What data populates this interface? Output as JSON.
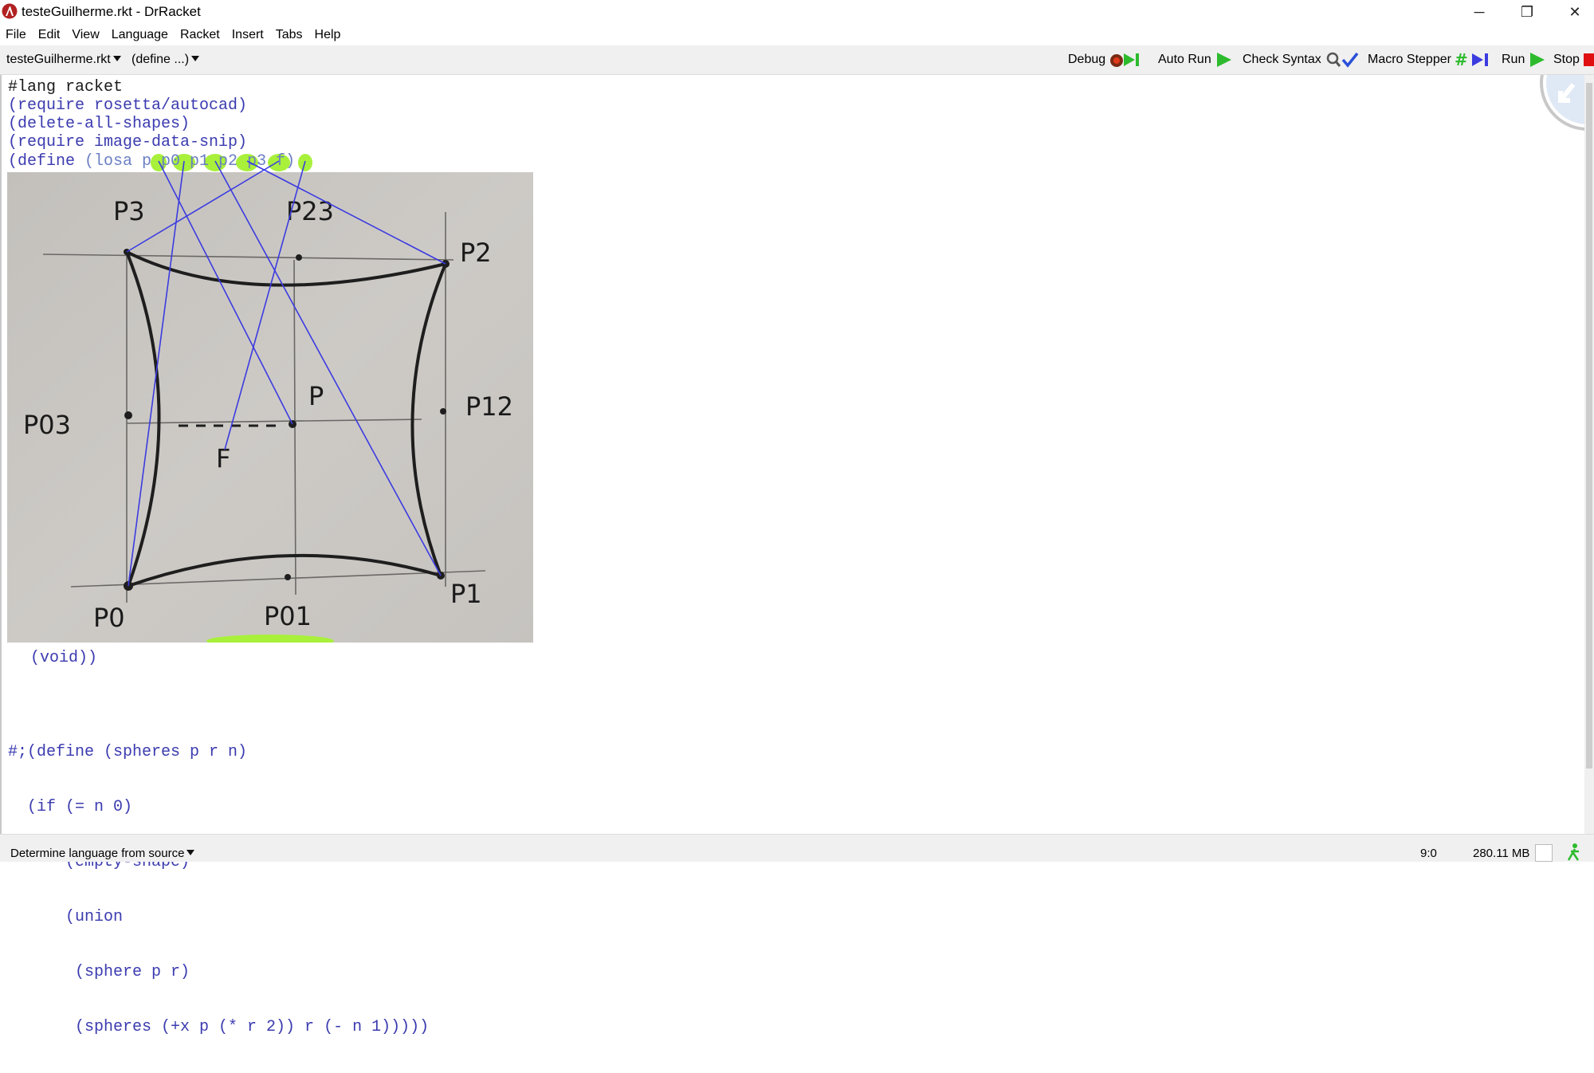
{
  "window": {
    "title": "testeGuilherme.rkt - DrRacket",
    "minimize": "─",
    "maximize": "❐",
    "close": "✕"
  },
  "menu": [
    "File",
    "Edit",
    "View",
    "Language",
    "Racket",
    "Insert",
    "Tabs",
    "Help"
  ],
  "toolbar": {
    "file_selector": "testeGuilherme.rkt",
    "define_selector": "(define ...)",
    "buttons": {
      "debug": "Debug",
      "auto_run": "Auto Run",
      "check_syntax": "Check Syntax",
      "macro_stepper": "Macro Stepper",
      "run": "Run",
      "stop": "Stop"
    }
  },
  "code": {
    "line1": "#lang racket",
    "line2": "(require rosetta/autocad)",
    "line3": "(delete-all-shapes)",
    "line4": "(require image-data-snip)",
    "define_kw": "(define",
    "define_sig": "(losa p p0 p1 p2 p3 f)",
    "void_line": "(void))",
    "block": [
      "#;(define (spheres p r n)",
      "  (if (= n 0)",
      "      (empty-shape)",
      "      (union",
      "       (sphere p r)",
      "       (spheres (+x p (* r 2)) r (- n 1)))))"
    ]
  },
  "sketch_labels": {
    "p3": "P3",
    "p23": "P23",
    "p2": "P2",
    "p12": "P12",
    "p": "P",
    "p03": "P03",
    "f": "F",
    "p0": "P0",
    "p01": "P01",
    "p1": "P1"
  },
  "status": {
    "language": "Determine language from source",
    "position": "9:0",
    "memory": "280.11 MB"
  },
  "colors": {
    "keyword": "#1b1b1b",
    "paren": "#8b3a2a",
    "identifier": "#3b3bb0",
    "comment": "#c2730d",
    "highlight": "#9ef01a",
    "arrow": "#3b3be0",
    "stop": "#e01010",
    "run_green": "#2dbb2d"
  }
}
